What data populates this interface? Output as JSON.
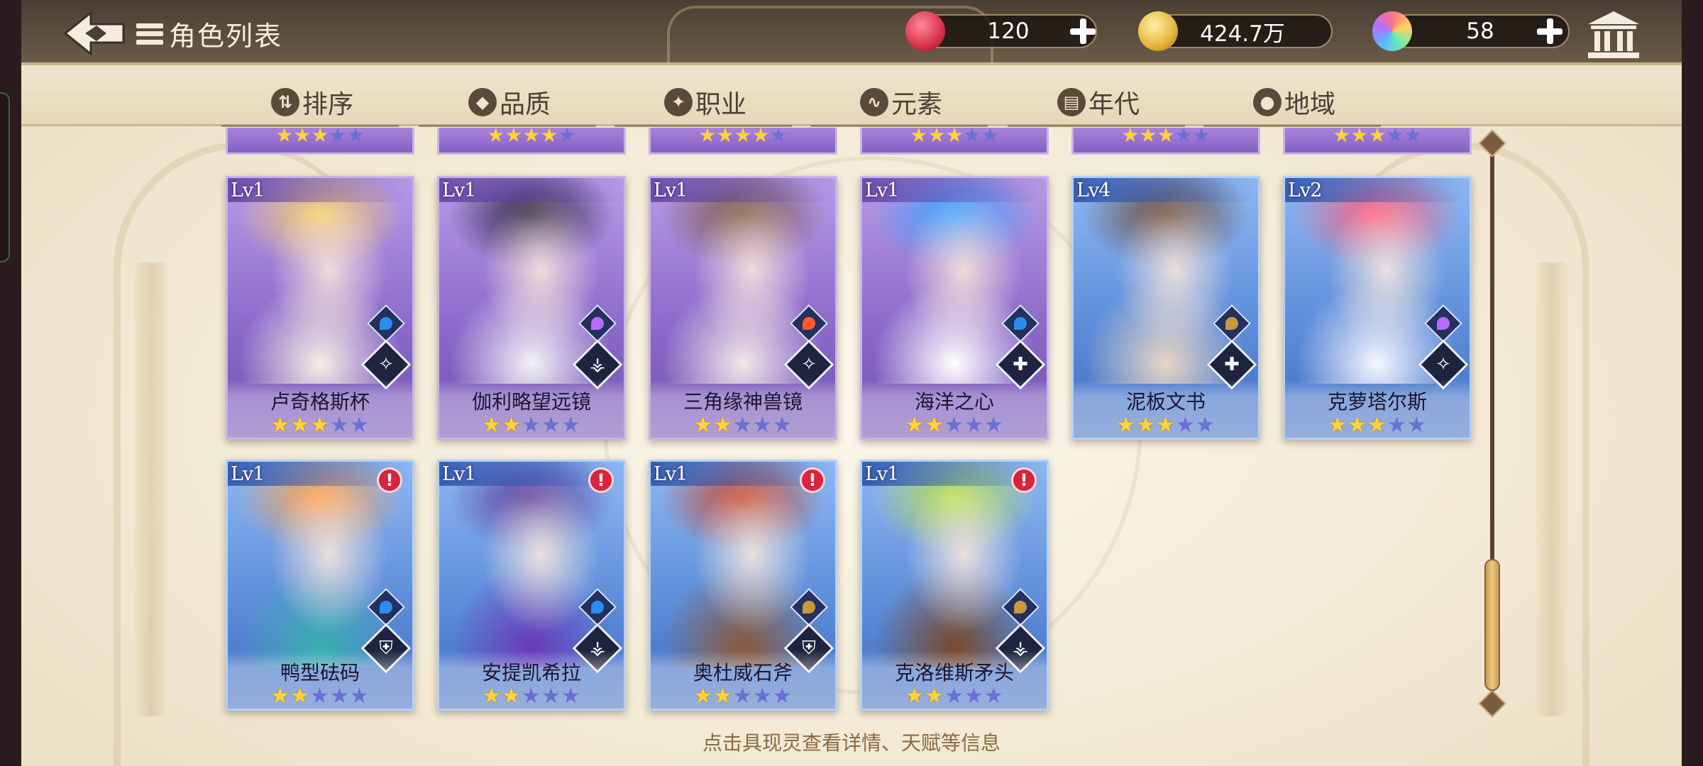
{
  "header": {
    "title": "角色列表",
    "resources": [
      {
        "name": "can",
        "icon": "soda-can-icon",
        "value": "120",
        "color": "#d9304a"
      },
      {
        "name": "coin",
        "icon": "gold-coin-icon",
        "value": "424.7万",
        "color": "#e6b33a"
      },
      {
        "name": "gem",
        "icon": "rainbow-gem-icon",
        "value": "58",
        "color": "#9a6cf0"
      }
    ]
  },
  "filters": [
    {
      "label": "排序",
      "icon": "sort-icon"
    },
    {
      "label": "品质",
      "icon": "quality-icon"
    },
    {
      "label": "职业",
      "icon": "class-icon"
    },
    {
      "label": "元素",
      "icon": "element-icon"
    },
    {
      "label": "年代",
      "icon": "era-icon"
    },
    {
      "label": "地域",
      "icon": "region-icon"
    }
  ],
  "previous_row_stars": [
    3,
    4,
    4,
    3,
    3,
    3
  ],
  "cards": [
    {
      "level": "Lv1",
      "name": "卢奇格斯杯",
      "stars": 3,
      "theme": "purple",
      "element": "water",
      "class": "mage",
      "alert": false
    },
    {
      "level": "Lv1",
      "name": "伽利略望远镜",
      "stars": 2,
      "theme": "purple",
      "element": "lightning",
      "class": "ranger",
      "alert": false
    },
    {
      "level": "Lv1",
      "name": "三角缘神兽镜",
      "stars": 2,
      "theme": "purple",
      "element": "fire",
      "class": "mage",
      "alert": false
    },
    {
      "level": "Lv1",
      "name": "海洋之心",
      "stars": 2,
      "theme": "purple",
      "element": "water",
      "class": "healer",
      "alert": false
    },
    {
      "level": "Lv4",
      "name": "泥板文书",
      "stars": 3,
      "theme": "blue",
      "element": "earth",
      "class": "healer",
      "alert": false
    },
    {
      "level": "Lv2",
      "name": "克萝塔尔斯",
      "stars": 3,
      "theme": "blue",
      "element": "lightning",
      "class": "mage",
      "alert": false
    },
    {
      "level": "Lv1",
      "name": "鸭型砝码",
      "stars": 2,
      "theme": "blue",
      "element": "water",
      "class": "guardian",
      "alert": true
    },
    {
      "level": "Lv1",
      "name": "安提凯希拉",
      "stars": 2,
      "theme": "blue",
      "element": "water",
      "class": "ranger",
      "alert": true
    },
    {
      "level": "Lv1",
      "name": "奥杜威石斧",
      "stars": 2,
      "theme": "blue",
      "element": "earth",
      "class": "guardian",
      "alert": true
    },
    {
      "level": "Lv1",
      "name": "克洛维斯矛头",
      "stars": 2,
      "theme": "blue",
      "element": "earth",
      "class": "ranger",
      "alert": true
    }
  ],
  "hint": "点击具现灵查看详情、天赋等信息"
}
